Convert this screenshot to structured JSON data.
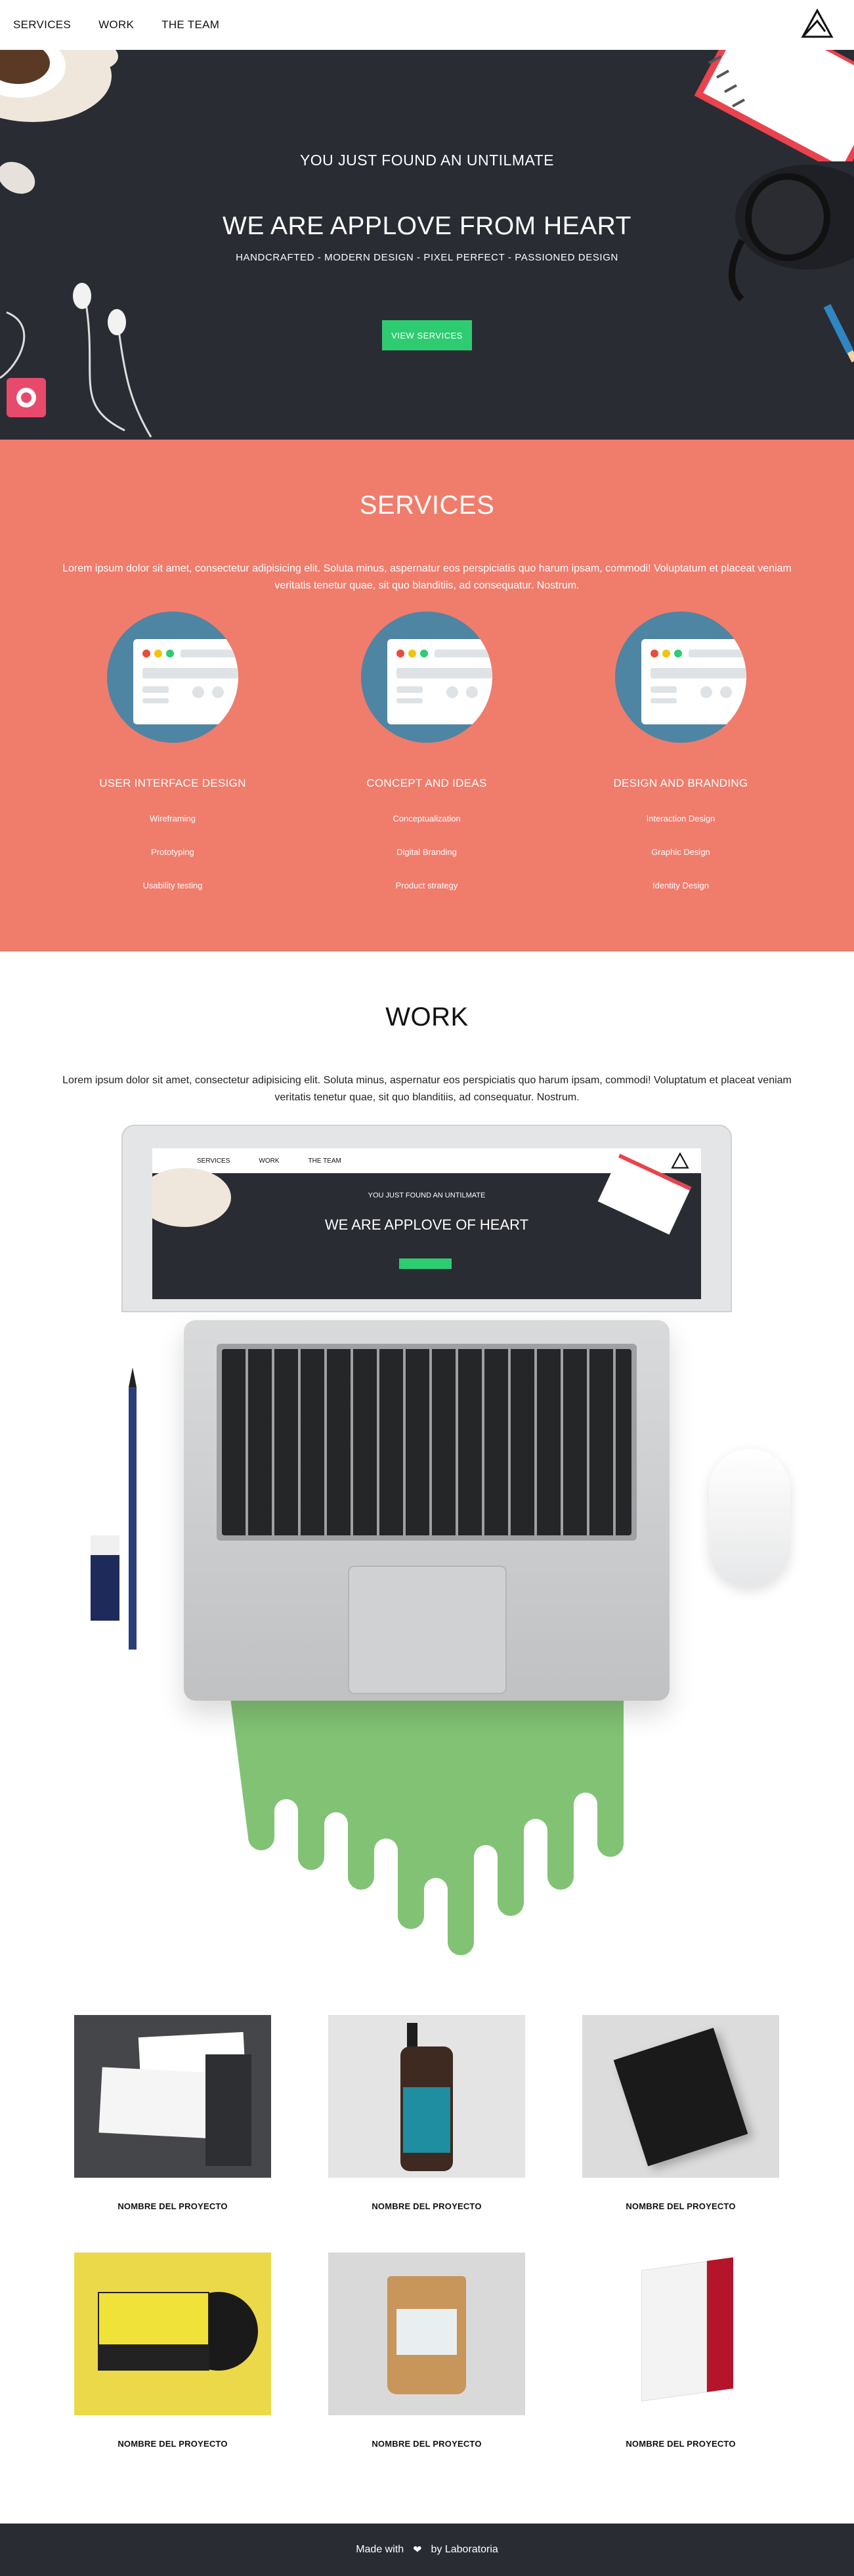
{
  "nav": {
    "items": [
      "SERVICES",
      "WORK",
      "THE TEAM"
    ]
  },
  "hero": {
    "subtitle": "YOU JUST FOUND AN UNTILMATE",
    "title": "WE ARE APPLOVE FROM HEART",
    "tagline": "HANDCRAFTED - MODERN DESIGN - PIXEL PERFECT - PASSIONED DESIGN",
    "button_label": "VIEW SERVICES"
  },
  "services": {
    "title": "SERVICES",
    "description": "Lorem ipsum dolor sit amet, consectetur adipisicing elit. Soluta minus, aspernatur eos perspiciatis quo harum ipsam, commodi! Voluptatum et placeat veniam veritatis tenetur quae, sit quo blanditiis, ad consequatur. Nostrum.",
    "columns": [
      {
        "name": "USER INTERFACE DESIGN",
        "items": [
          "Wireframing",
          "Prototyping",
          "Usability testing"
        ]
      },
      {
        "name": "CONCEPT AND IDEAS",
        "items": [
          "Conceptualization",
          "Digital Branding",
          "Product strategy"
        ]
      },
      {
        "name": "DESIGN AND BRANDING",
        "items": [
          "Interaction Design",
          "Graphic Design",
          "Identity Design"
        ]
      }
    ]
  },
  "work": {
    "title": "WORK",
    "description": "Lorem ipsum dolor sit amet, consectetur adipisicing elit. Soluta minus, aspernatur eos perspiciatis quo harum ipsam, commodi! Voluptatum et placeat veniam veritatis tenetur quae, sit quo blanditiis, ad consequatur. Nostrum.",
    "laptop_screen": {
      "nav": [
        "SERVICES",
        "WORK",
        "THE TEAM"
      ],
      "subtitle": "YOU JUST FOUND AN UNTILMATE",
      "title": "WE ARE APPLOVE OF HEART"
    },
    "projects": [
      {
        "name": "NOMBRE DEL PROYECTO"
      },
      {
        "name": "NOMBRE DEL PROYECTO"
      },
      {
        "name": "NOMBRE DEL PROYECTO"
      },
      {
        "name": "NOMBRE DEL PROYECTO"
      },
      {
        "name": "NOMBRE DEL PROYECTO"
      },
      {
        "name": "NOMBRE DEL PROYECTO"
      }
    ]
  },
  "footer": {
    "made_with": "Made with",
    "heart_icon": "heart-icon",
    "by": "by Laboratoria"
  },
  "colors": {
    "dark": "#2a2c34",
    "coral": "#f07c6c",
    "green": "#2ecc71",
    "slime": "#82c275"
  }
}
